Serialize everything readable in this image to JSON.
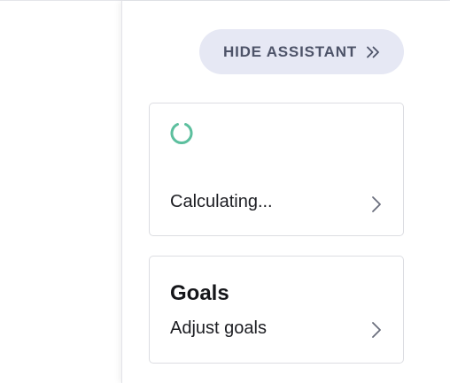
{
  "assistant": {
    "hide_label": "HIDE ASSISTANT",
    "hide_icon": "double-chevron-right-icon"
  },
  "cards": {
    "calculating": {
      "status_text": "Calculating...",
      "spinner_icon": "loading-spinner-icon",
      "spinner_color": "#5cbf9e"
    },
    "goals": {
      "title": "Goals",
      "link_text": "Adjust goals"
    }
  },
  "colors": {
    "button_bg": "#e6e8f4",
    "button_text": "#4d5368",
    "card_border": "#dcdde2"
  }
}
